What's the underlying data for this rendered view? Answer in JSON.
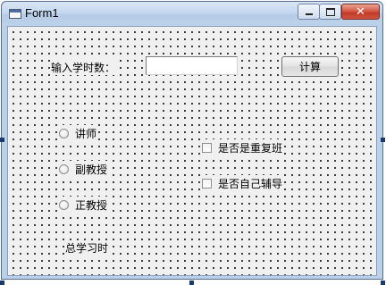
{
  "window": {
    "title": "Form1"
  },
  "caption_buttons": {
    "minimize": "minimize-icon",
    "maximize": "maximize-icon",
    "close": "close-icon"
  },
  "form": {
    "hours_label": "输入学时数：",
    "hours_input": {
      "value": "",
      "placeholder": ""
    },
    "calculate_button": "计算",
    "titles": [
      {
        "label": "讲师",
        "selected": false
      },
      {
        "label": "副教授",
        "selected": false
      },
      {
        "label": "正教授",
        "selected": false
      }
    ],
    "options": [
      {
        "label": "是否是重复班",
        "checked": false
      },
      {
        "label": "是否自己辅导",
        "checked": false
      }
    ],
    "total_label": "总学习时"
  }
}
